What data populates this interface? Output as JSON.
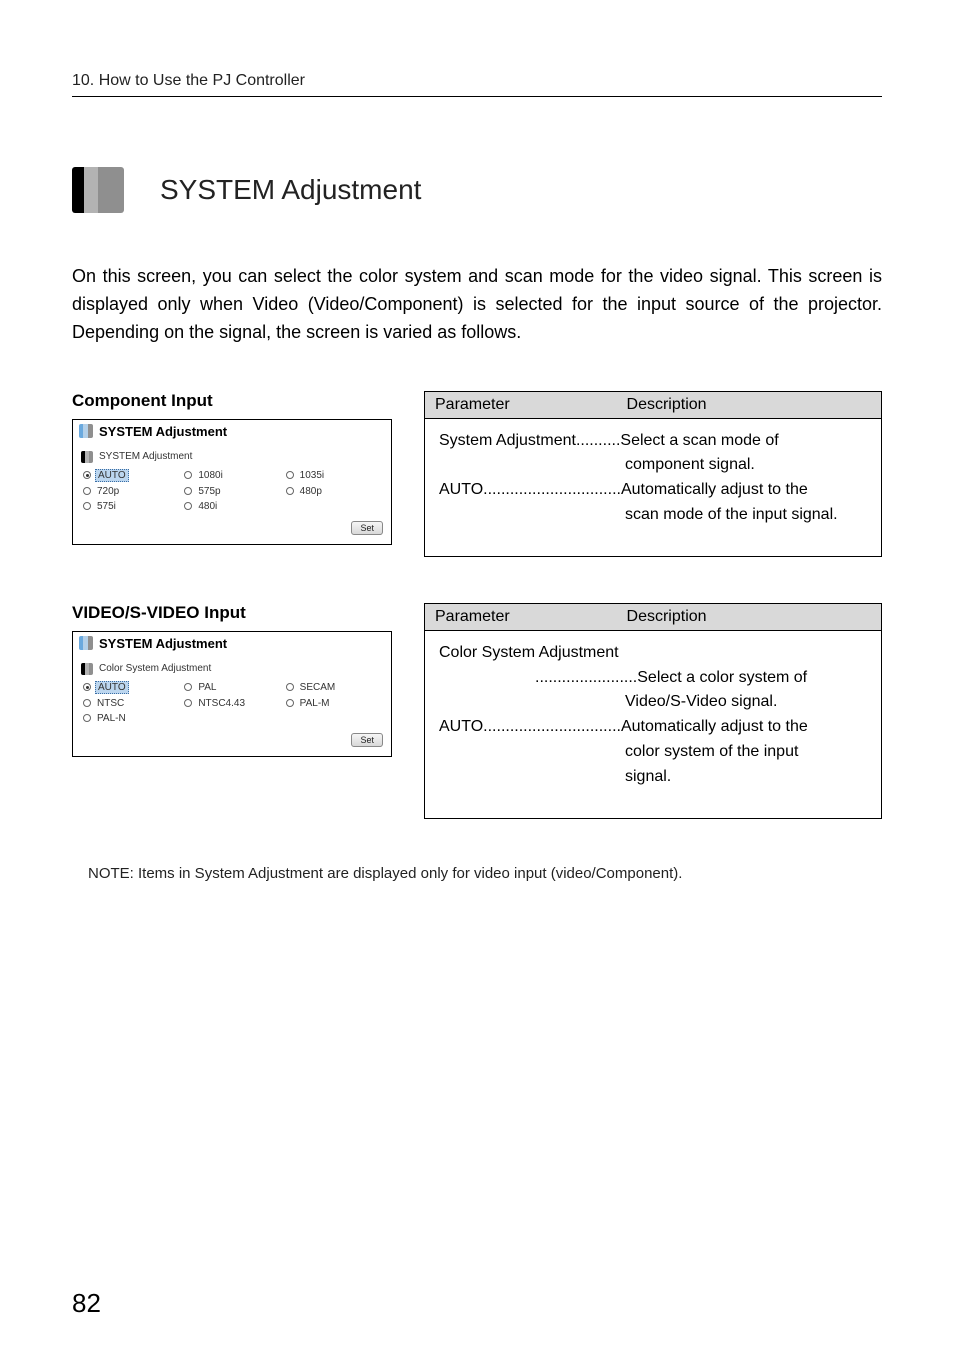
{
  "header": {
    "breadcrumb": "10. How to Use the PJ Controller"
  },
  "title": "SYSTEM Adjustment",
  "intro": "On this screen, you can select the color system and scan mode for the video signal. This screen is displayed only when Video (Video/Component) is selected for the input source of the projector. Depending on the signal, the screen is varied as follows.",
  "sections": {
    "component": {
      "heading": "Component Input",
      "panel_title": "SYSTEM Adjustment",
      "panel_subtitle": "SYSTEM Adjustment",
      "set_label": "Set",
      "options": [
        {
          "label": "AUTO",
          "selected": true
        },
        {
          "label": "1080i",
          "selected": false
        },
        {
          "label": "1035i",
          "selected": false
        },
        {
          "label": "720p",
          "selected": false
        },
        {
          "label": "575p",
          "selected": false
        },
        {
          "label": "480p",
          "selected": false
        },
        {
          "label": "575i",
          "selected": false
        },
        {
          "label": "480i",
          "selected": false
        }
      ],
      "table": {
        "h1": "Parameter",
        "h2": "Description",
        "row1_param": "System Adjustment",
        "row1_dots": "..........",
        "row1_desc_a": "Select a scan mode of",
        "row1_desc_b": "component signal.",
        "row2_param": "AUTO",
        "row2_dots": "...............................",
        "row2_desc_a": "Automatically adjust to the",
        "row2_desc_b": "scan mode of the input signal."
      }
    },
    "video": {
      "heading": "VIDEO/S-VIDEO Input",
      "panel_title": "SYSTEM Adjustment",
      "panel_subtitle": "Color System Adjustment",
      "set_label": "Set",
      "options": [
        {
          "label": "AUTO",
          "selected": true
        },
        {
          "label": "PAL",
          "selected": false
        },
        {
          "label": "SECAM",
          "selected": false
        },
        {
          "label": "NTSC",
          "selected": false
        },
        {
          "label": "NTSC4.43",
          "selected": false
        },
        {
          "label": "PAL-M",
          "selected": false
        },
        {
          "label": "PAL-N",
          "selected": false
        }
      ],
      "table": {
        "h1": "Parameter",
        "h2": "Description",
        "row1_param": "Color System Adjustment",
        "row1_dots": ".......................",
        "row1_desc_a": "Select a color system of",
        "row1_desc_b": "Video/S-Video signal.",
        "row2_param": "AUTO",
        "row2_dots": "...............................",
        "row2_desc_a": "Automatically adjust to the",
        "row2_desc_b": "color system of the input",
        "row2_desc_c": "signal."
      }
    }
  },
  "note": "NOTE: Items in System Adjustment are displayed only for video input (video/Component).",
  "page_number": "82"
}
